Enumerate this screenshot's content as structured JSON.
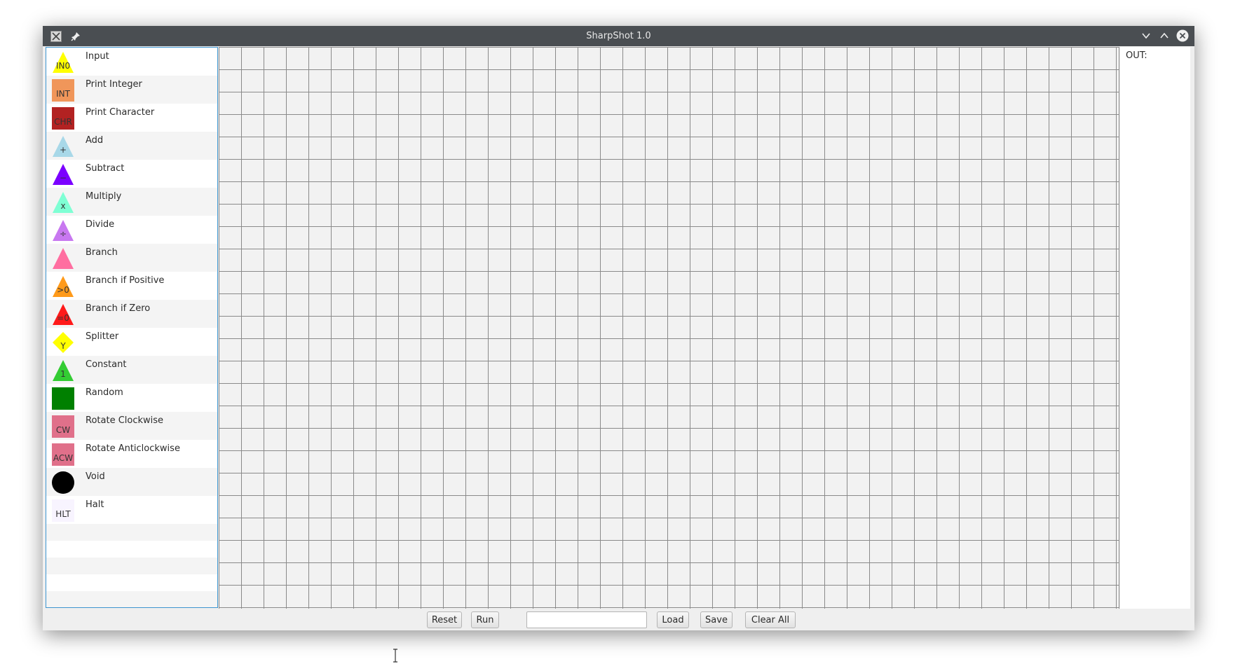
{
  "window": {
    "title": "SharpShot 1.0",
    "icons": {
      "app": "app-logo-icon",
      "pin": "pin-icon",
      "minimize": "chevron-down-icon",
      "maximize": "chevron-up-icon",
      "close": "close-icon"
    }
  },
  "palette": {
    "items": [
      {
        "label": "Input",
        "icon_text": "IN0",
        "shape": "triangle",
        "color": "#ffff00"
      },
      {
        "label": "Print Integer",
        "icon_text": "INT",
        "shape": "square",
        "color": "#f0965a"
      },
      {
        "label": "Print Character",
        "icon_text": "CHR",
        "shape": "square",
        "color": "#b22222"
      },
      {
        "label": "Add",
        "icon_text": "+",
        "shape": "triangle",
        "color": "#a8d8e8"
      },
      {
        "label": "Subtract",
        "icon_text": "−",
        "shape": "triangle",
        "color": "#7b00ff"
      },
      {
        "label": "Multiply",
        "icon_text": "x",
        "shape": "triangle",
        "color": "#7fffd4"
      },
      {
        "label": "Divide",
        "icon_text": "÷",
        "shape": "triangle",
        "color": "#c878f0"
      },
      {
        "label": "Branch",
        "icon_text": "",
        "shape": "triangle",
        "color": "#ff6ea0"
      },
      {
        "label": "Branch if Positive",
        "icon_text": ">0",
        "shape": "triangle",
        "color": "#ff9a1a"
      },
      {
        "label": "Branch if Zero",
        "icon_text": "=0",
        "shape": "triangle",
        "color": "#ff1a1a"
      },
      {
        "label": "Splitter",
        "icon_text": "Y",
        "shape": "diamond",
        "color": "#ffff00"
      },
      {
        "label": "Constant",
        "icon_text": "1",
        "shape": "triangle",
        "color": "#33cc33"
      },
      {
        "label": "Random",
        "icon_text": "",
        "shape": "square",
        "color": "#008000"
      },
      {
        "label": "Rotate Clockwise",
        "icon_text": "CW",
        "shape": "square",
        "color": "#e0708a"
      },
      {
        "label": "Rotate Anticlockwise",
        "icon_text": "ACW",
        "shape": "square",
        "color": "#e0708a"
      },
      {
        "label": "Void",
        "icon_text": "",
        "shape": "circle",
        "color": "#000000"
      },
      {
        "label": "Halt",
        "icon_text": "HLT",
        "shape": "square",
        "color": "#f8f4ff"
      }
    ]
  },
  "output": {
    "label": "OUT:"
  },
  "toolbar": {
    "reset": "Reset",
    "run": "Run",
    "file_field_value": "",
    "load": "Load",
    "save": "Save",
    "clear_all": "Clear All"
  },
  "colors": {
    "titlebar": "#4a4e52",
    "grid_line": "#8a8a8a",
    "palette_border": "#3d95cf"
  }
}
